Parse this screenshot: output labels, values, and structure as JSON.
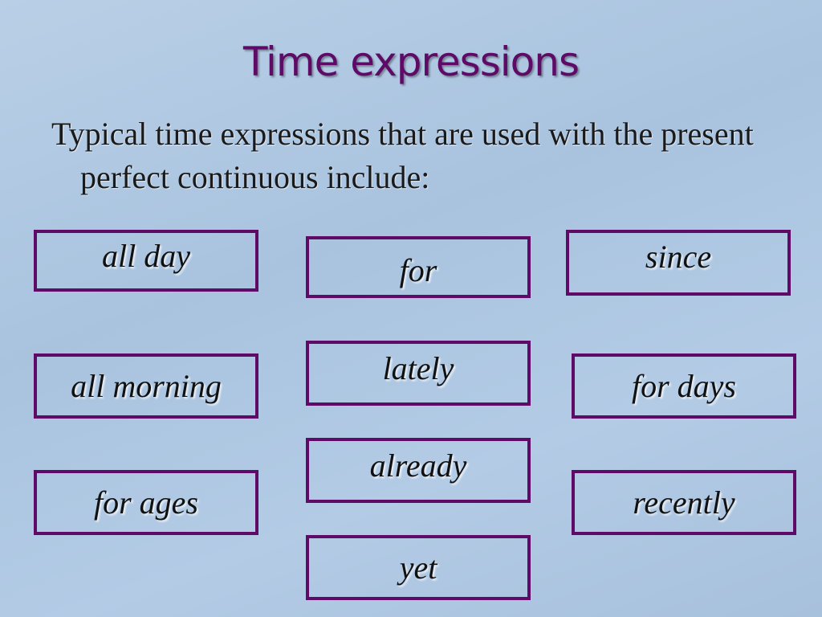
{
  "slide": {
    "title": "Time expressions",
    "intro": "Typical time expressions that are used with the present perfect continuous include:",
    "expressions": [
      "all day",
      "for",
      "since",
      "all morning",
      "lately",
      "for days",
      "for ages",
      "already",
      "recently",
      "yet"
    ]
  }
}
